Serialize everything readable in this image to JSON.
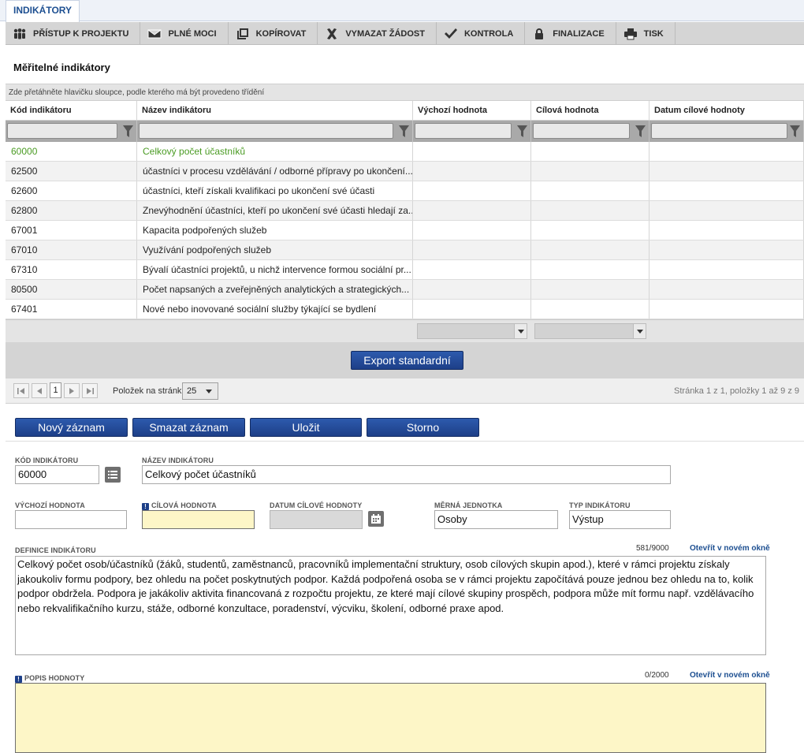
{
  "tab": {
    "label": "INDIKÁTORY"
  },
  "toolbar": {
    "items": [
      {
        "label": "PŘÍSTUP K PROJEKTU",
        "icon": "people-icon"
      },
      {
        "label": "PLNÉ MOCI",
        "icon": "envelope-icon"
      },
      {
        "label": "KOPÍROVAT",
        "icon": "copy-icon"
      },
      {
        "label": "VYMAZAT ŽÁDOST",
        "icon": "x-icon"
      },
      {
        "label": "KONTROLA",
        "icon": "check-icon"
      },
      {
        "label": "FINALIZACE",
        "icon": "lock-icon"
      },
      {
        "label": "TISK",
        "icon": "printer-icon"
      }
    ]
  },
  "section": {
    "title": "Měřitelné indikátory"
  },
  "grid": {
    "group_hint": "Zde přetáhněte hlavičku sloupce, podle kterého má být provedeno třídění",
    "columns": [
      "Kód indikátoru",
      "Název indikátoru",
      "Výchozí hodnota",
      "Cílová hodnota",
      "Datum cílové hodnoty"
    ],
    "rows": [
      {
        "code": "60000",
        "name": "Celkový počet účastníků",
        "selected": true
      },
      {
        "code": "62500",
        "name": "účastníci v procesu vzdělávání / odborné přípravy po ukončení..."
      },
      {
        "code": "62600",
        "name": "účastníci, kteří získali kvalifikaci po ukončení své účasti"
      },
      {
        "code": "62800",
        "name": "Znevýhodnění účastníci, kteří po ukončení své účasti hledají za..."
      },
      {
        "code": "67001",
        "name": "Kapacita podpořených služeb"
      },
      {
        "code": "67010",
        "name": "Využívání podpořených služeb"
      },
      {
        "code": "67310",
        "name": "Bývalí účastníci projektů, u nichž intervence formou sociální pr..."
      },
      {
        "code": "80500",
        "name": "Počet napsaných a zveřejněných analytických a strategických..."
      },
      {
        "code": "67401",
        "name": "Nové nebo inovované sociální služby týkající se bydlení"
      }
    ],
    "export_label": "Export standardní"
  },
  "pager": {
    "current_page": "1",
    "page_size_label": "Položek na stránku",
    "page_size": "25",
    "info": "Stránka 1 z 1, položky 1 až 9 z 9"
  },
  "form": {
    "buttons": {
      "new": "Nový záznam",
      "delete": "Smazat záznam",
      "save": "Uložit",
      "cancel": "Storno"
    },
    "kod": {
      "label": "KÓD INDIKÁTORU",
      "value": "60000"
    },
    "nazev": {
      "label": "NÁZEV INDIKÁTORU",
      "value": "Celkový počet účastníků"
    },
    "vychozi": {
      "label": "VÝCHOZÍ HODNOTA",
      "value": ""
    },
    "cilova": {
      "label": "CÍLOVÁ HODNOTA",
      "value": ""
    },
    "datum": {
      "label": "DATUM CÍLOVÉ HODNOTY",
      "value": ""
    },
    "merna": {
      "label": "MĚRNÁ JEDNOTKA",
      "value": "Osoby"
    },
    "typ": {
      "label": "TYP INDIKÁTORU",
      "value": "Výstup"
    },
    "definice": {
      "label": "DEFINICE INDIKÁTORU",
      "counter": "581/9000",
      "link": "Otevřít v novém okně",
      "text": "Celkový počet osob/účastníků (žáků, studentů, zaměstnanců, pracovníků implementační struktury, osob cílových skupin apod.), které v rámci projektu získaly jakoukoliv formu podpory, bez ohledu na počet poskytnutých podpor. Každá podpořená osoba se v rámci projektu započítává pouze jednou bez ohledu na to, kolik podpor obdržela. Podpora je jakákoliv aktivita financovaná z rozpočtu projektu, ze které mají cílové skupiny prospěch, podpora může mít formu např. vzdělávacího nebo rekvalifikačního kurzu, stáže, odborné konzultace, poradenství, výcviku, školení, odborné praxe apod."
    },
    "popis": {
      "label": "POPIS HODNOTY",
      "counter": "0/2000",
      "link": "Otevřít v novém okně",
      "text": ""
    }
  },
  "colors": {
    "accent": "#1d3f88",
    "selected_row_text": "#4a9b23",
    "required_bg": "#fdf6c7"
  }
}
